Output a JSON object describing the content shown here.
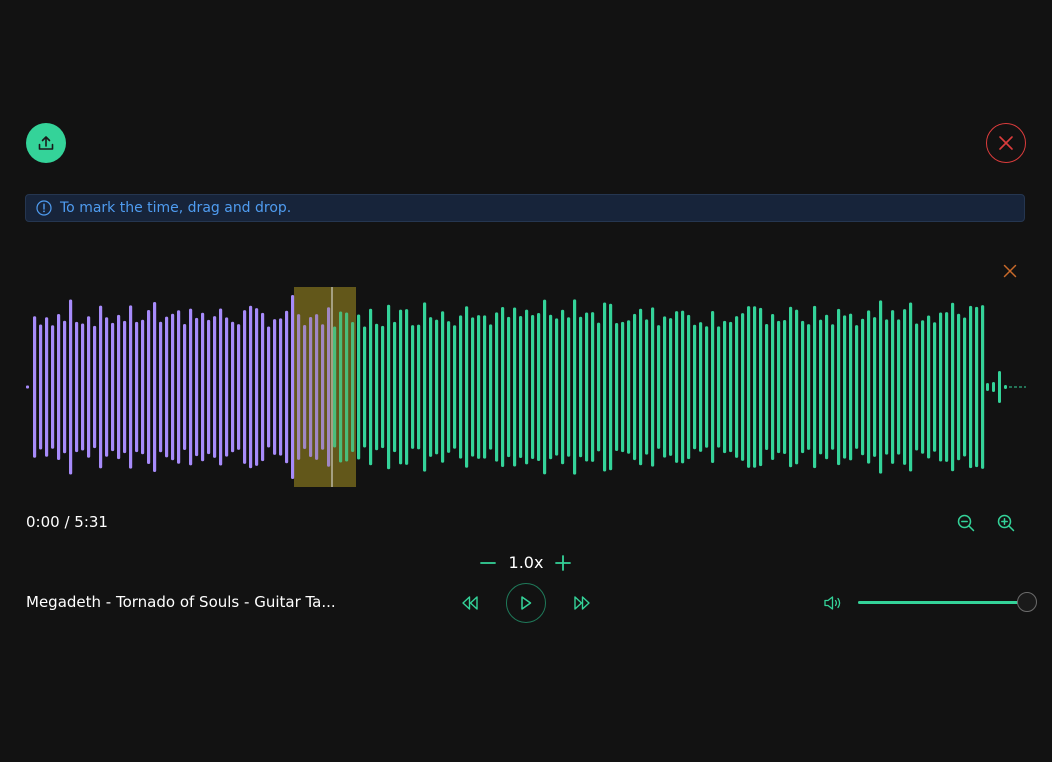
{
  "colors": {
    "accent": "#34d399",
    "played": "#a78bfa",
    "region": "#8b7a1e",
    "close": "#dc3c3c",
    "info_text": "#4f9cf0",
    "clear_region": "#c8692a"
  },
  "toolbar": {
    "upload_icon": "upload-icon",
    "close_icon": "close-icon"
  },
  "info": {
    "icon": "info-circle-icon",
    "text": "To mark the time, drag and drop."
  },
  "waveform": {
    "progress": 0.306,
    "region_start": 0.268,
    "region_end": 0.33,
    "clear_icon": "close-icon"
  },
  "playback": {
    "time": "0:00 / 5:31",
    "rate": "1.0x",
    "track_title": "Megadeth - Tornado of Souls - Guitar Ta..."
  },
  "volume": {
    "level": 1.0
  }
}
